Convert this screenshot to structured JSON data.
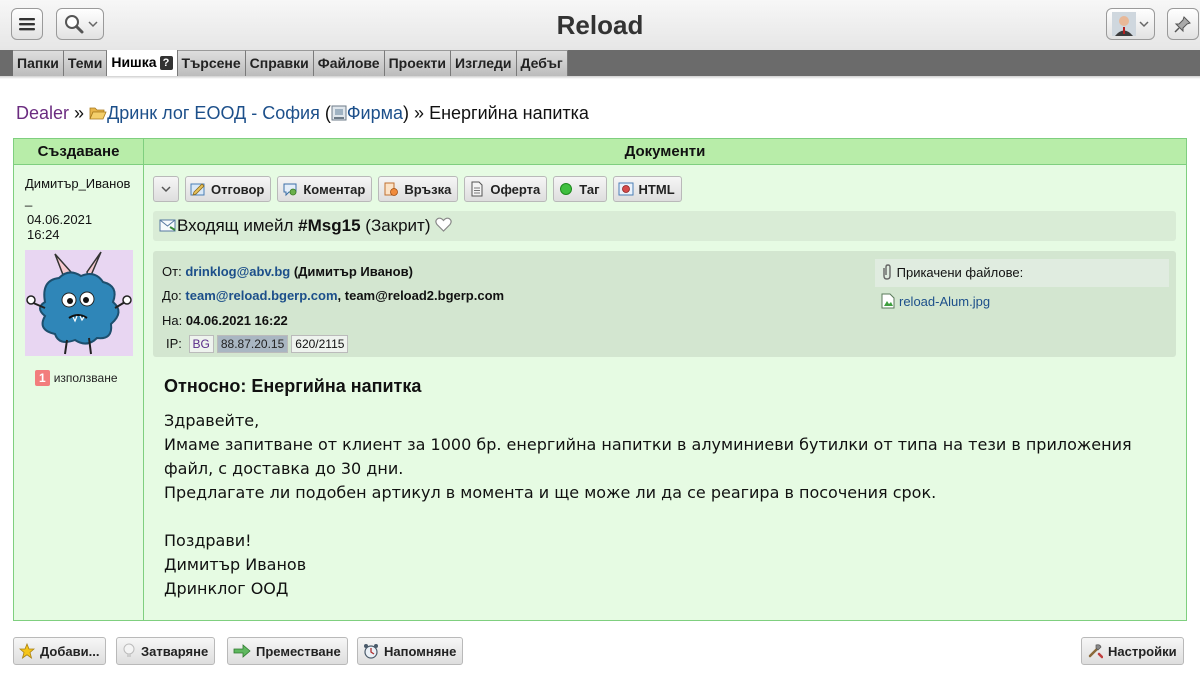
{
  "header": {
    "title": "Reload",
    "menu_icon": "hamburger-icon",
    "search_icon": "magnifier-icon",
    "user_icon": "user-avatar-icon",
    "pin_icon": "pin-icon"
  },
  "tabs": [
    {
      "label": "Папки",
      "active": false
    },
    {
      "label": "Теми",
      "active": false
    },
    {
      "label": "Нишка",
      "active": true,
      "badge": "?"
    },
    {
      "label": "Търсене",
      "active": false
    },
    {
      "label": "Справки",
      "active": false
    },
    {
      "label": "Файлове",
      "active": false
    },
    {
      "label": "Проекти",
      "active": false
    },
    {
      "label": "Изгледи",
      "active": false
    },
    {
      "label": "Дебъг",
      "active": false
    }
  ],
  "breadcrumb": {
    "root": "Dealer",
    "separator": "»",
    "folder": "Дринк лог ЕООД - София",
    "folder_type_open": "(",
    "folder_type": "Фирма",
    "folder_type_close": ")",
    "current": "Енергийна напитка"
  },
  "table": {
    "col_created": "Създаване",
    "col_documents": "Документи"
  },
  "author": {
    "name": "Димитър_Иванов_",
    "date": "04.06.2021",
    "time": "16:24",
    "usage_count": "1",
    "usage_label": "използване"
  },
  "doc_toolbar": {
    "reply": "Отговор",
    "comment": "Коментар",
    "link": "Връзка",
    "offer": "Оферта",
    "tag": "Таг",
    "html": "HTML"
  },
  "email": {
    "title_prefix": "Входящ имейл",
    "handle": "#Msg15",
    "state": "(Закрит)",
    "from_label": "От:",
    "from_email": "drinklog@abv.bg",
    "from_name": "(Димитър Иванов)",
    "to_label": "До:",
    "to_email_1": "team@reload.bgerp.com",
    "to_email_2": ", team@reload2.bgerp.com",
    "date_label": "На:",
    "date_value": "04.06.2021 16:22",
    "ip_label": "IP:",
    "ip_country": "BG",
    "ip_address": "88.87.20.15",
    "ip_count": "620/2115",
    "attachments_label": "Прикачени файлове:",
    "attachment_file": "reload-Alum.jpg",
    "subject": "Относно: Енергийна напитка",
    "body": [
      "Здравейте,",
      "Имаме запитване от клиент за 1000 бр. енергийна напитки в алуминиеви бутилки от типа на тези в приложения файл, с доставка до 30 дни.",
      "Предлагате ли подобен артикул в момента и ще може ли да се реагира в посочения срок.",
      "",
      "Поздрави!",
      "Димитър Иванов",
      "Дринклог ООД"
    ]
  },
  "footer": {
    "add": "Добави...",
    "close": "Затваряне",
    "move": "Преместване",
    "remind": "Напомняне",
    "settings": "Настройки"
  }
}
